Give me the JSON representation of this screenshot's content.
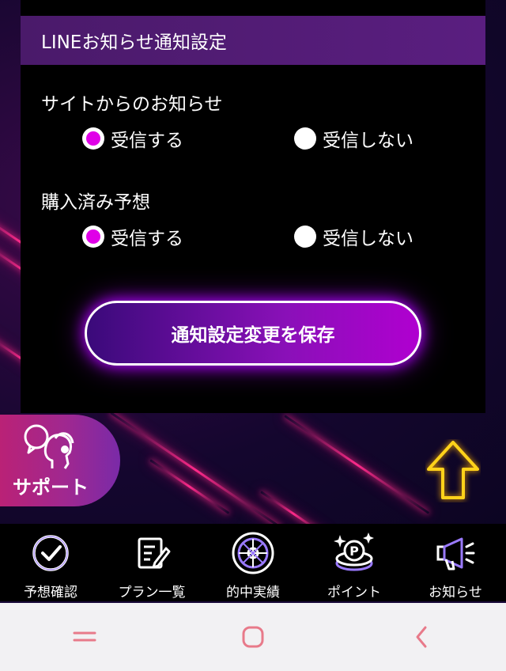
{
  "settings": {
    "header": "LINEお知らせ通知設定",
    "groups": [
      {
        "title": "サイトからのお知らせ",
        "options": [
          {
            "label": "受信する",
            "selected": true
          },
          {
            "label": "受信しない",
            "selected": false
          }
        ]
      },
      {
        "title": "購入済み予想",
        "options": [
          {
            "label": "受信する",
            "selected": true
          },
          {
            "label": "受信しない",
            "selected": false
          }
        ]
      }
    ],
    "save_label": "通知設定変更を保存"
  },
  "support": {
    "label": "サポート",
    "icon": "headset-person-icon"
  },
  "scroll_top_icon": "up-arrow-icon",
  "bottom_nav": [
    {
      "label": "予想確認",
      "icon": "check-circle-icon"
    },
    {
      "label": "プラン一覧",
      "icon": "document-edit-icon"
    },
    {
      "label": "的中実績",
      "icon": "roulette-wheel-icon"
    },
    {
      "label": "ポイント",
      "icon": "point-coin-icon"
    },
    {
      "label": "お知らせ",
      "icon": "megaphone-icon"
    }
  ],
  "system_nav": [
    {
      "icon": "menu-icon"
    },
    {
      "icon": "home-icon"
    },
    {
      "icon": "back-icon"
    }
  ],
  "colors": {
    "accent": "#e000e8",
    "header_bg": "#4a1a6a",
    "neon_purple": "#b000ff",
    "neon_yellow": "#ffd21a",
    "icon_purple": "#9a7aff",
    "system_icon": "#e87a8a"
  }
}
